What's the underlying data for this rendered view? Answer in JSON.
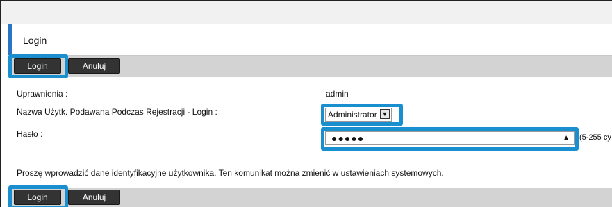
{
  "page": {
    "title": "Login"
  },
  "toolbar_top": {
    "login_label": "Login",
    "cancel_label": "Anuluj"
  },
  "toolbar_bottom": {
    "login_label": "Login",
    "cancel_label": "Anuluj"
  },
  "form": {
    "permissions_label": "Uprawnienia :",
    "permissions_value": "admin",
    "username_label": "Nazwa Użytk. Podawana Podczas Rejestracji - Login :",
    "username_selected": "Administrator",
    "password_label": "Hasło :",
    "password_masked": "●●●●●",
    "password_hint": "(5-255 cy"
  },
  "message": "Proszę wprowadzić dane identyfikacyjne użytkownika. Ten komunikat można zmienić w ustawieniach systemowych.",
  "colors": {
    "highlight": "#1a8fd0",
    "button_bg": "#333333",
    "toolbar_bg": "#d3d3d3",
    "title_accent": "#2a74c4"
  }
}
